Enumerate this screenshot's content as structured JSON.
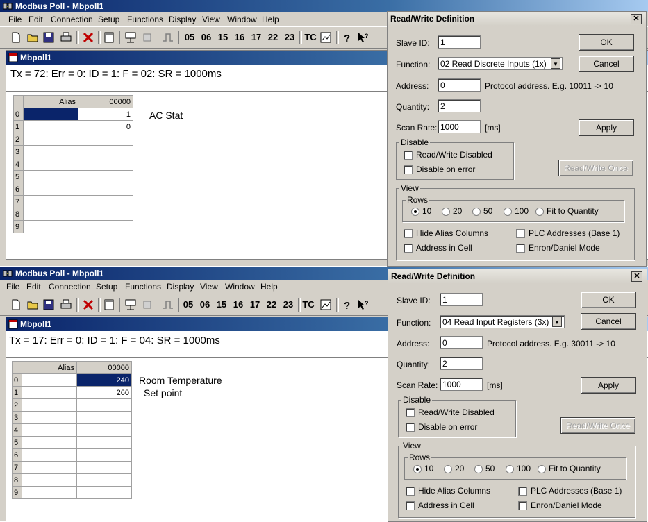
{
  "panels": [
    {
      "app_title": "Modbus Poll - Mbpoll1",
      "menu": [
        "File",
        "Edit",
        "Connection",
        "Setup",
        "Functions",
        "Display",
        "View",
        "Window",
        "Help"
      ],
      "toolbar_codes": [
        "05",
        "06",
        "15",
        "16",
        "17",
        "22",
        "23",
        "TC"
      ],
      "mdi_title": "Mbpoll1",
      "status": "Tx = 72: Err = 0: ID = 1: F = 02: SR = 1000ms",
      "grid": {
        "col_alias": "Alias",
        "col_addr": "00000",
        "rows": [
          {
            "n": "0",
            "alias": "",
            "value": "1"
          },
          {
            "n": "1",
            "alias": "",
            "value": "0"
          },
          {
            "n": "2",
            "alias": "",
            "value": ""
          },
          {
            "n": "3",
            "alias": "",
            "value": ""
          },
          {
            "n": "4",
            "alias": "",
            "value": ""
          },
          {
            "n": "5",
            "alias": "",
            "value": ""
          },
          {
            "n": "6",
            "alias": "",
            "value": ""
          },
          {
            "n": "7",
            "alias": "",
            "value": ""
          },
          {
            "n": "8",
            "alias": "",
            "value": ""
          },
          {
            "n": "9",
            "alias": "",
            "value": ""
          }
        ]
      },
      "annotations": [
        "AC Stat"
      ],
      "dialog": {
        "title": "Read/Write Definition",
        "slave_id_label": "Slave ID:",
        "slave_id": "1",
        "function_label": "Function:",
        "function": "02 Read Discrete Inputs (1x)",
        "address_label": "Address:",
        "address": "0",
        "address_hint": "Protocol address. E.g. 10011 -> 10",
        "quantity_label": "Quantity:",
        "quantity": "2",
        "scan_rate_label": "Scan Rate:",
        "scan_rate": "1000",
        "scan_unit": "[ms]",
        "ok": "OK",
        "cancel": "Cancel",
        "apply": "Apply",
        "rw_once": "Read/Write Once",
        "disable_group": "Disable",
        "rw_disabled": "Read/Write Disabled",
        "disable_on_error": "Disable on error",
        "view_group": "View",
        "rows_group": "Rows",
        "row_options": [
          "10",
          "20",
          "50",
          "100",
          "Fit to Quantity"
        ],
        "rows_selected": "10",
        "hide_alias": "Hide Alias Columns",
        "plc_addr": "PLC Addresses (Base 1)",
        "addr_in_cell": "Address in Cell",
        "enron": "Enron/Daniel Mode"
      }
    },
    {
      "app_title": "Modbus Poll - Mbpoll1",
      "menu": [
        "File",
        "Edit",
        "Connection",
        "Setup",
        "Functions",
        "Display",
        "View",
        "Window",
        "Help"
      ],
      "toolbar_codes": [
        "05",
        "06",
        "15",
        "16",
        "17",
        "22",
        "23",
        "TC"
      ],
      "mdi_title": "Mbpoll1",
      "status": "Tx = 17: Err = 0: ID = 1: F = 04: SR = 1000ms",
      "grid": {
        "col_alias": "Alias",
        "col_addr": "00000",
        "rows": [
          {
            "n": "0",
            "alias": "",
            "value": "240"
          },
          {
            "n": "1",
            "alias": "",
            "value": "260"
          },
          {
            "n": "2",
            "alias": "",
            "value": ""
          },
          {
            "n": "3",
            "alias": "",
            "value": ""
          },
          {
            "n": "4",
            "alias": "",
            "value": ""
          },
          {
            "n": "5",
            "alias": "",
            "value": ""
          },
          {
            "n": "6",
            "alias": "",
            "value": ""
          },
          {
            "n": "7",
            "alias": "",
            "value": ""
          },
          {
            "n": "8",
            "alias": "",
            "value": ""
          },
          {
            "n": "9",
            "alias": "",
            "value": ""
          }
        ]
      },
      "annotations": [
        "Room Temperature",
        "Set point"
      ],
      "dialog": {
        "title": "Read/Write Definition",
        "slave_id_label": "Slave ID:",
        "slave_id": "1",
        "function_label": "Function:",
        "function": "04 Read Input Registers (3x)",
        "address_label": "Address:",
        "address": "0",
        "address_hint": "Protocol address. E.g. 30011 -> 10",
        "quantity_label": "Quantity:",
        "quantity": "2",
        "scan_rate_label": "Scan Rate:",
        "scan_rate": "1000",
        "scan_unit": "[ms]",
        "ok": "OK",
        "cancel": "Cancel",
        "apply": "Apply",
        "rw_once": "Read/Write Once",
        "disable_group": "Disable",
        "rw_disabled": "Read/Write Disabled",
        "disable_on_error": "Disable on error",
        "view_group": "View",
        "rows_group": "Rows",
        "row_options": [
          "10",
          "20",
          "50",
          "100",
          "Fit to Quantity"
        ],
        "rows_selected": "10",
        "hide_alias": "Hide Alias Columns",
        "plc_addr": "PLC Addresses (Base 1)",
        "addr_in_cell": "Address in Cell",
        "enron": "Enron/Daniel Mode"
      }
    }
  ]
}
